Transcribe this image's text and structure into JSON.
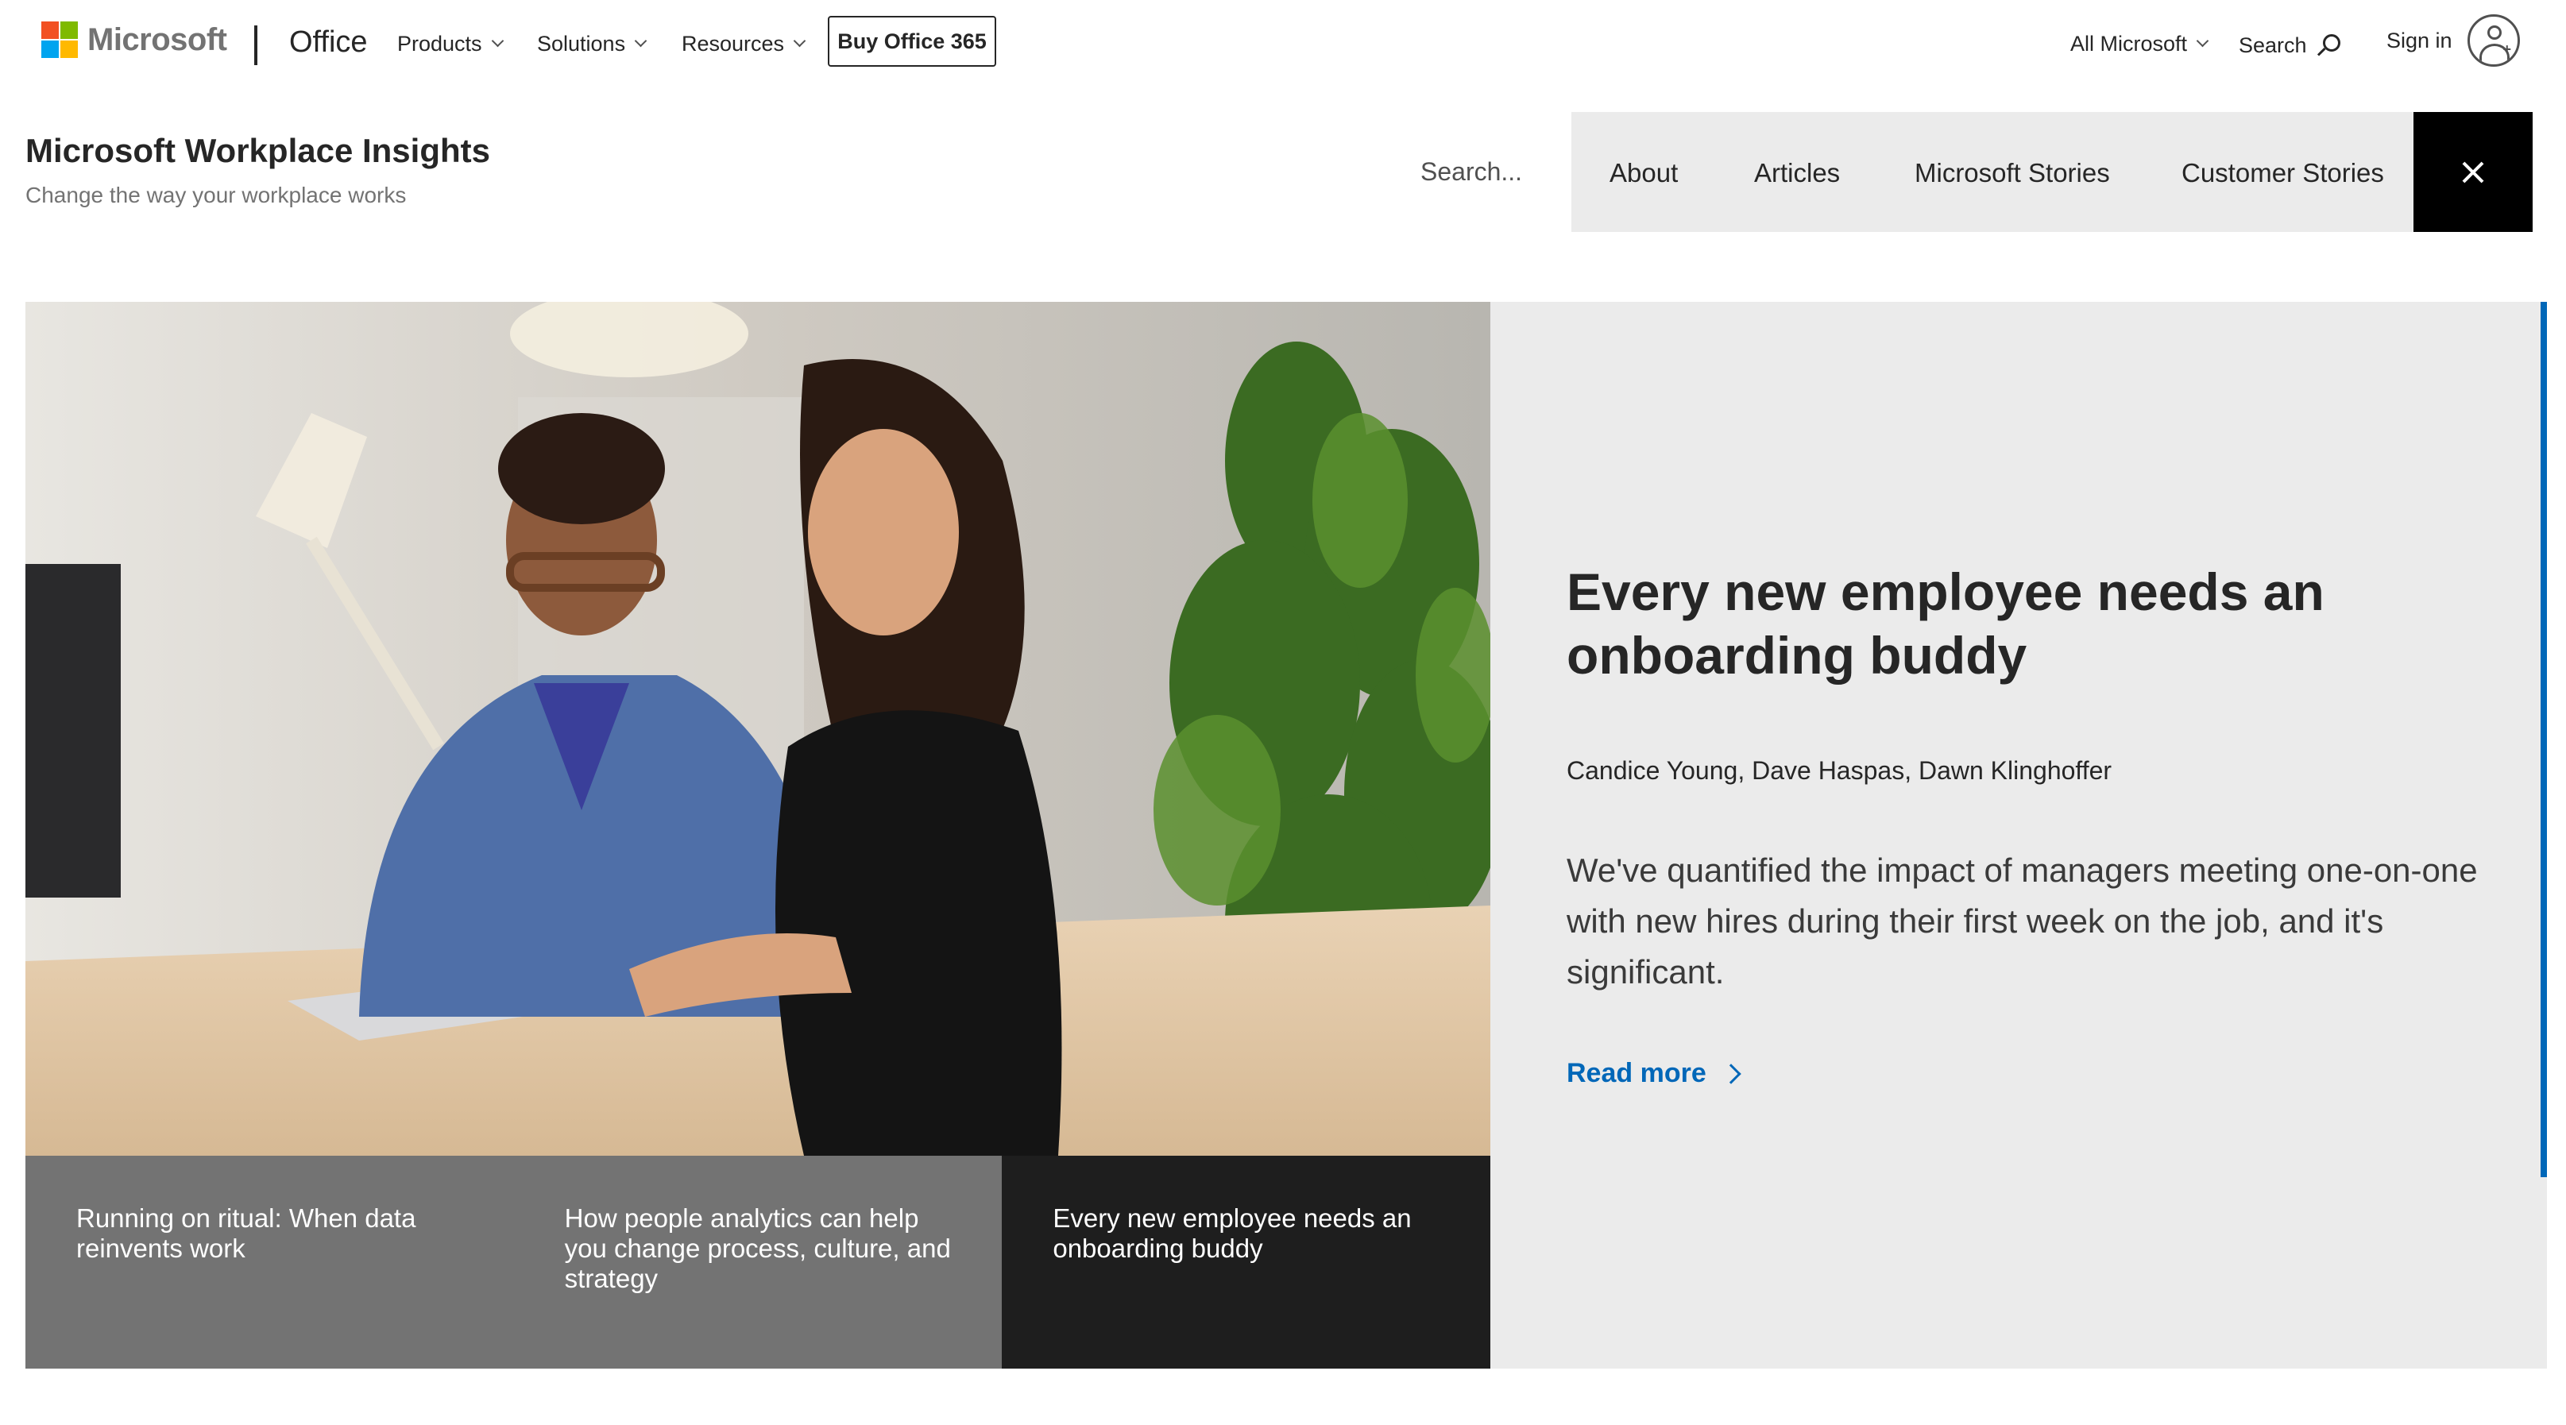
{
  "global_header": {
    "brand": "Microsoft",
    "product": "Office",
    "menus": [
      {
        "label": "Products"
      },
      {
        "label": "Solutions"
      },
      {
        "label": "Resources"
      }
    ],
    "buy_button": "Buy Office 365",
    "all_microsoft": "All Microsoft",
    "search": "Search",
    "sign_in": "Sign in"
  },
  "site": {
    "title": "Microsoft Workplace Insights",
    "subtitle": "Change the way your workplace works",
    "search_placeholder": "Search...",
    "nav": [
      {
        "label": "About"
      },
      {
        "label": "Articles"
      },
      {
        "label": "Microsoft Stories"
      },
      {
        "label": "Customer Stories"
      }
    ]
  },
  "hero": {
    "title": "Every new employee needs an onboarding buddy",
    "authors": "Candice Young, Dave Haspas, Dawn Klinghoffer",
    "description": "We've quantified the impact of managers meeting one-on-one with new hires during their first week on the job, and it's significant.",
    "read_more": "Read more",
    "accent_color": "#0067b8"
  },
  "carousel": {
    "cards": [
      {
        "label": "Running on ritual: When data reinvents work",
        "active": false
      },
      {
        "label": "How people analytics can help you change process, culture, and strategy",
        "active": false
      },
      {
        "label": "Every new employee needs an onboarding buddy",
        "active": true
      }
    ]
  },
  "icons": [
    "microsoft-logo",
    "chevron-down-icon",
    "search-icon",
    "user-avatar-icon",
    "close-icon",
    "chevron-right-icon"
  ]
}
